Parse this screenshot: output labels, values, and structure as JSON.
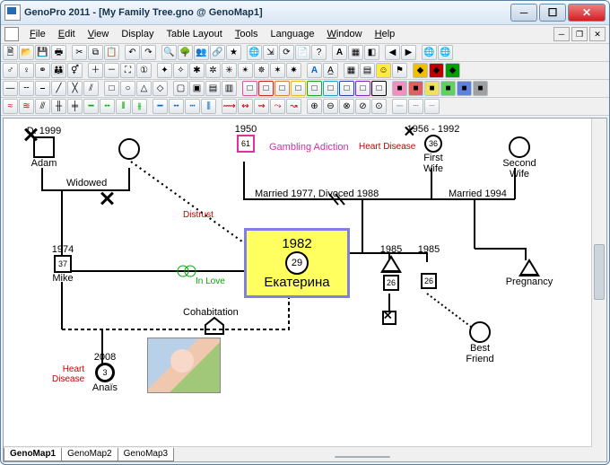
{
  "window": {
    "title": "GenoPro 2011 - [My Family Tree.gno @ GenoMap1]"
  },
  "menu": {
    "items": [
      "File",
      "Edit",
      "View",
      "Display",
      "Table Layout",
      "Tools",
      "Language",
      "Window",
      "Help"
    ]
  },
  "tabs": {
    "items": [
      "GenoMap1",
      "GenoMap2",
      "GenoMap3"
    ],
    "active": 0
  },
  "people": {
    "adam": {
      "death": "D. 1999",
      "name": "Adam"
    },
    "widow": {
      "label": "Widowed"
    },
    "p1950": {
      "year": "1950",
      "age": "61",
      "cond": "Gambling Adiction"
    },
    "firstwife": {
      "range": "1956 - 1992",
      "age": "36",
      "name": "First\nWife",
      "cond": "Heart Disease"
    },
    "secondwife": {
      "name": "Second\nWife"
    },
    "marriage1": {
      "label": "Married 1977, Divoced 1988"
    },
    "marriage2": {
      "label": "Married 1994"
    },
    "distrust": {
      "label": "Distrust"
    },
    "mike": {
      "year": "1974",
      "age": "37",
      "name": "Mike"
    },
    "inlove": {
      "label": "In Love"
    },
    "ekat": {
      "year": "1982",
      "age": "29",
      "name": "Екатерина"
    },
    "cohab": {
      "label": "Cohabitation"
    },
    "c1985a": {
      "year": "1985",
      "age": "26"
    },
    "c1985b": {
      "year": "1985",
      "age": "26"
    },
    "preg": {
      "label": "Pregnancy"
    },
    "bestfriend": {
      "label": "Best\nFriend"
    },
    "anais": {
      "year": "2008",
      "age": "3",
      "name": "Anaïs",
      "cond": "Heart\nDisease"
    }
  }
}
